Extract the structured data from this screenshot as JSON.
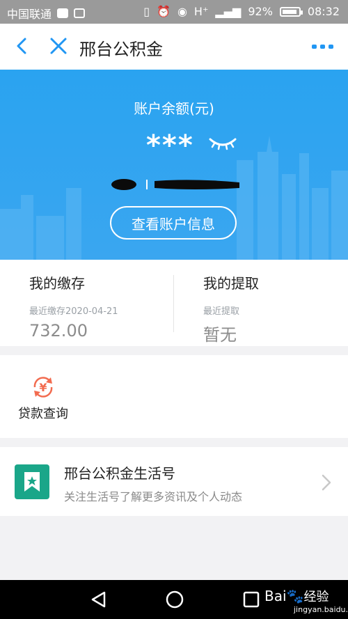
{
  "status_bar": {
    "carrier": "中国联通",
    "network": "H⁺",
    "battery": "92%",
    "time": "08:32"
  },
  "header": {
    "title": "邢台公积金"
  },
  "account": {
    "balance_label": "账户余额(元)",
    "balance_masked": "***",
    "view_button": "查看账户信息"
  },
  "summary": {
    "deposit": {
      "title": "我的缴存",
      "sub": "最近缴存2020-04-21",
      "value": "732.00"
    },
    "withdraw": {
      "title": "我的提取",
      "sub": "最近提取",
      "value": "暂无"
    }
  },
  "services": {
    "loan_query": "贷款查询"
  },
  "life_account": {
    "title": "邢台公积金生活号",
    "desc": "关注生活号了解更多资讯及个人动态"
  },
  "watermark": {
    "logo": "Bai",
    "logo_cn": "经验",
    "domain": "jingyan.baidu.com"
  },
  "colors": {
    "accent": "#2196f3",
    "hero": "#2aa3f0",
    "loan_icon": "#f26b4f",
    "life_icon": "#1aa689"
  }
}
